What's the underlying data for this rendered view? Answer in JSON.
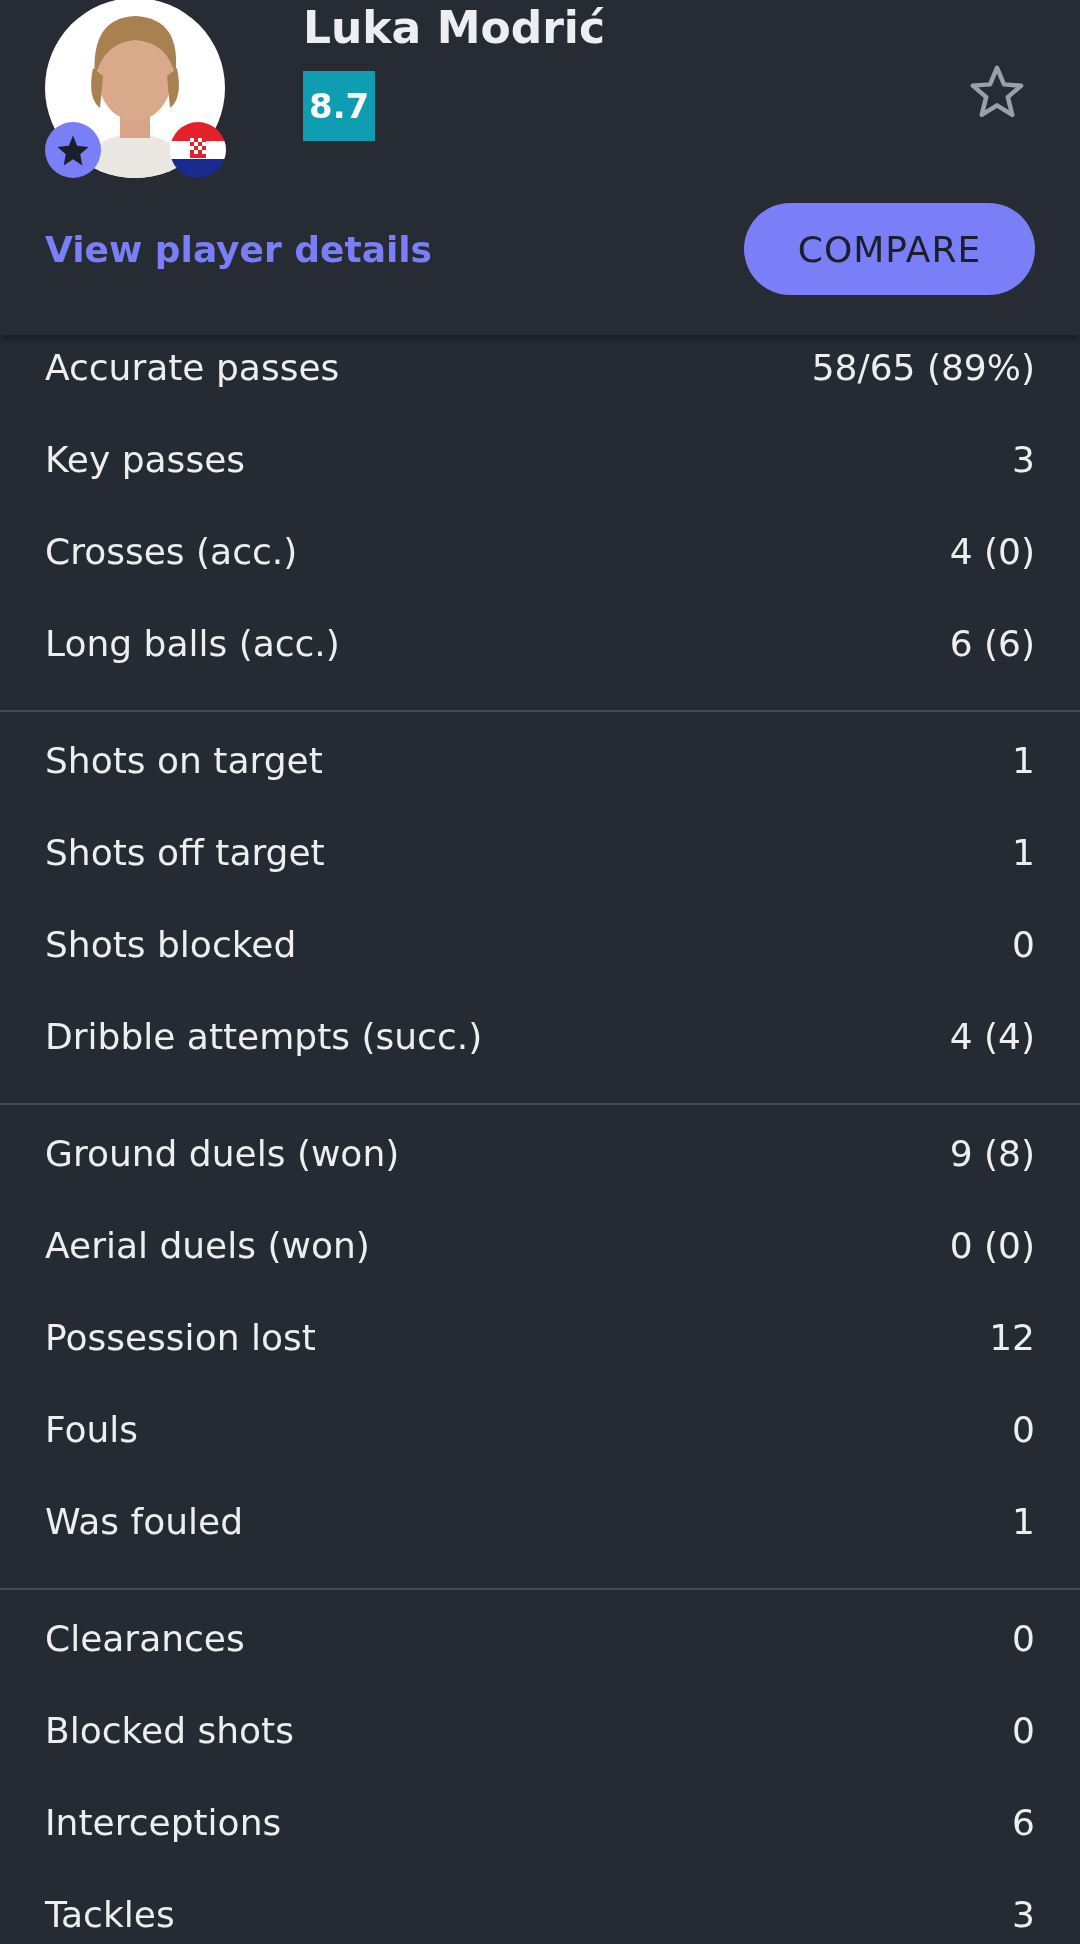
{
  "player": {
    "name": "Luka Modrić",
    "rating": "8.7",
    "favorite": false
  },
  "details_link": "View player details",
  "compare_button": "COMPARE",
  "stat_groups": [
    {
      "rows": [
        {
          "label": "Accurate passes",
          "value": "58/65 (89%)"
        },
        {
          "label": "Key passes",
          "value": "3"
        },
        {
          "label": "Crosses (acc.)",
          "value": "4 (0)"
        },
        {
          "label": "Long balls (acc.)",
          "value": "6 (6)"
        }
      ]
    },
    {
      "rows": [
        {
          "label": "Shots on target",
          "value": "1"
        },
        {
          "label": "Shots off target",
          "value": "1"
        },
        {
          "label": "Shots blocked",
          "value": "0"
        },
        {
          "label": "Dribble attempts (succ.)",
          "value": "4 (4)"
        }
      ]
    },
    {
      "rows": [
        {
          "label": "Ground duels (won)",
          "value": "9 (8)"
        },
        {
          "label": "Aerial duels (won)",
          "value": "0 (0)"
        },
        {
          "label": "Possession lost",
          "value": "12"
        },
        {
          "label": "Fouls",
          "value": "0"
        },
        {
          "label": "Was fouled",
          "value": "1"
        }
      ]
    },
    {
      "rows": [
        {
          "label": "Clearances",
          "value": "0"
        },
        {
          "label": "Blocked shots",
          "value": "0"
        },
        {
          "label": "Interceptions",
          "value": "6"
        },
        {
          "label": "Tackles",
          "value": "3"
        }
      ]
    }
  ]
}
